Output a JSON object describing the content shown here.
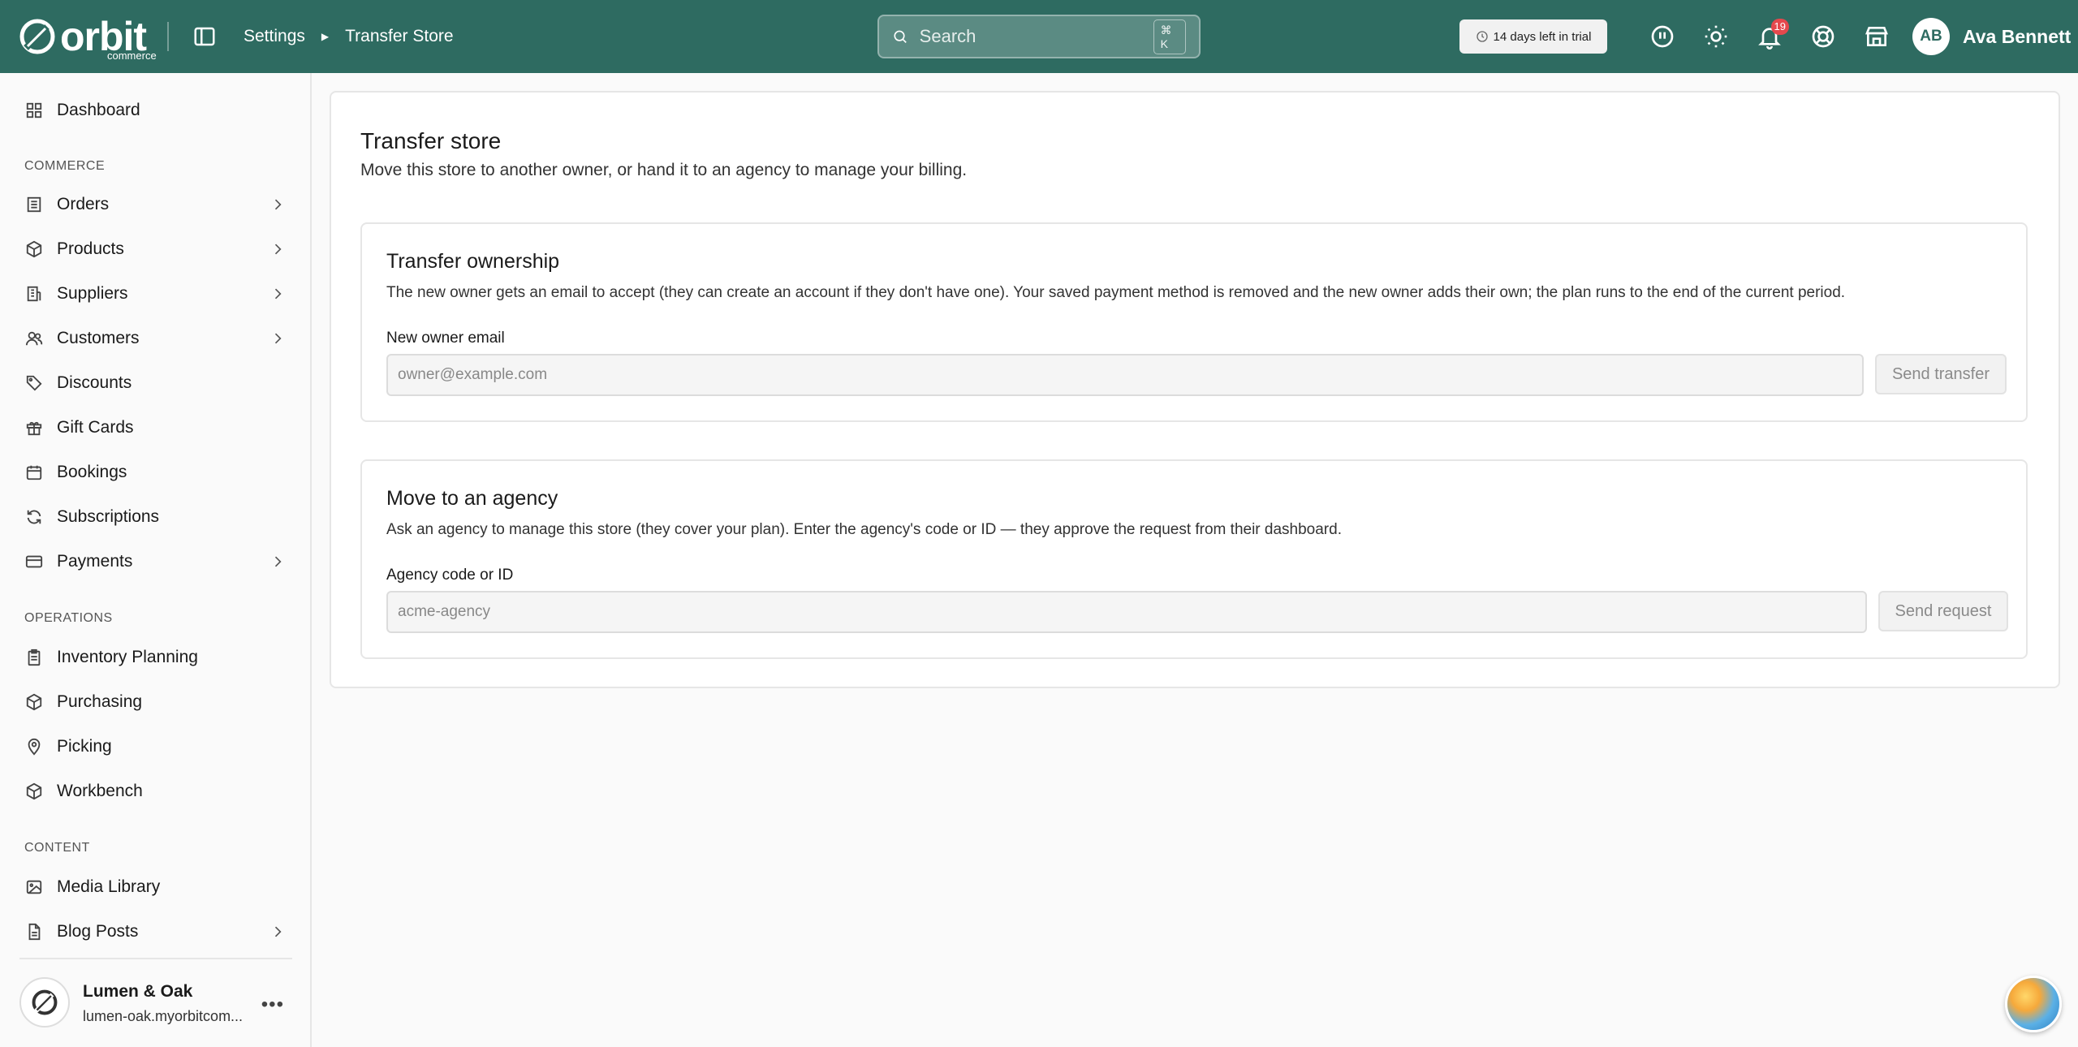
{
  "header": {
    "logo_text": "orbit",
    "logo_sub": "commerce",
    "breadcrumb": [
      "Settings",
      "Transfer Store"
    ],
    "search_placeholder": "Search",
    "search_shortcut": "⌘ K",
    "trial_text": "14 days left in trial",
    "notifications_count": "19",
    "user_initials": "AB",
    "user_name": "Ava Bennett",
    "brand_color": "#2e6b61"
  },
  "sidebar": {
    "top_items": [
      {
        "label": "Dashboard",
        "icon": "dashboard-icon"
      }
    ],
    "sections": [
      {
        "label": "COMMERCE",
        "items": [
          {
            "label": "Orders",
            "icon": "orders-icon",
            "has_children": true
          },
          {
            "label": "Products",
            "icon": "box-icon",
            "has_children": true
          },
          {
            "label": "Suppliers",
            "icon": "building-icon",
            "has_children": true
          },
          {
            "label": "Customers",
            "icon": "users-icon",
            "has_children": true
          },
          {
            "label": "Discounts",
            "icon": "tag-icon",
            "has_children": false
          },
          {
            "label": "Gift Cards",
            "icon": "gift-icon",
            "has_children": false
          },
          {
            "label": "Bookings",
            "icon": "calendar-icon",
            "has_children": false
          },
          {
            "label": "Subscriptions",
            "icon": "refresh-icon",
            "has_children": false
          },
          {
            "label": "Payments",
            "icon": "card-icon",
            "has_children": true
          }
        ]
      },
      {
        "label": "OPERATIONS",
        "items": [
          {
            "label": "Inventory Planning",
            "icon": "clipboard-icon",
            "has_children": false
          },
          {
            "label": "Purchasing",
            "icon": "box-icon",
            "has_children": false
          },
          {
            "label": "Picking",
            "icon": "pin-icon",
            "has_children": false
          },
          {
            "label": "Workbench",
            "icon": "box-icon",
            "has_children": false
          }
        ]
      },
      {
        "label": "CONTENT",
        "items": [
          {
            "label": "Media Library",
            "icon": "image-icon",
            "has_children": false
          },
          {
            "label": "Blog Posts",
            "icon": "document-icon",
            "has_children": true
          }
        ]
      }
    ],
    "store": {
      "name": "Lumen & Oak",
      "url": "lumen-oak.myorbitcom..."
    }
  },
  "main": {
    "title": "Transfer store",
    "subtitle": "Move this store to another owner, or hand it to an agency to manage your billing.",
    "transfer": {
      "title": "Transfer ownership",
      "description": "The new owner gets an email to accept (they can create an account if they don't have one). Your saved payment method is removed and the new owner adds their own; the plan runs to the end of the current period.",
      "field_label": "New owner email",
      "placeholder": "owner@example.com",
      "button": "Send transfer"
    },
    "agency": {
      "title": "Move to an agency",
      "description": "Ask an agency to manage this store (they cover your plan). Enter the agency's code or ID — they approve the request from their dashboard.",
      "field_label": "Agency code or ID",
      "placeholder": "acme-agency",
      "button": "Send request"
    }
  }
}
